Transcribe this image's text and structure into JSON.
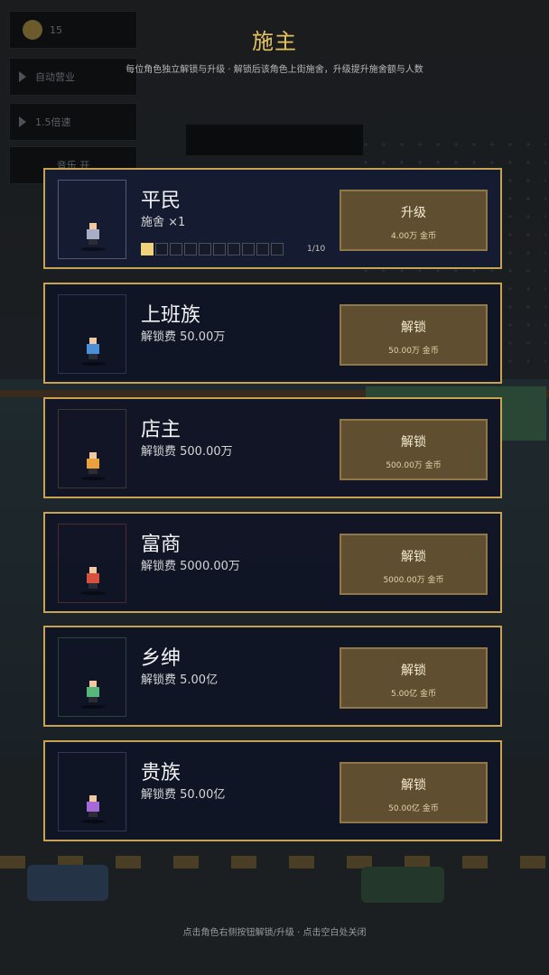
{
  "hud": {
    "coin_value": "15",
    "button1": "自动营业",
    "button2": "1.5倍速",
    "button3": "音乐 开"
  },
  "header": {
    "title": "施主",
    "subtitle": "每位角色独立解锁与升级 · 解锁后该角色上街施舍，升级提升施舍额与人数"
  },
  "colors": {
    "gold": "#c7a253",
    "title": "#e4c35e",
    "button": "#5f4f30"
  },
  "progress": {
    "filled": 1,
    "total": 10,
    "level_text": "1/10"
  },
  "cards": [
    {
      "name": "平民",
      "info": "施舍 ×1",
      "button_label": "升级",
      "button_price": "4.00万 金币",
      "shirt_color": "#a7aec5",
      "frame_color": "#505a74"
    },
    {
      "name": "上班族",
      "info": "解锁费 50.00万",
      "button_label": "解锁",
      "button_price": "50.00万 金币",
      "shirt_color": "#4a8fd8",
      "frame_color": "#2a3653"
    },
    {
      "name": "店主",
      "info": "解锁费 500.00万",
      "button_label": "解锁",
      "button_price": "500.00万 金币",
      "shirt_color": "#e8a13c",
      "frame_color": "#3e3632"
    },
    {
      "name": "富商",
      "info": "解锁费 5000.00万",
      "button_label": "解锁",
      "button_price": "5000.00万 金币",
      "shirt_color": "#d8503e",
      "frame_color": "#4a2b31"
    },
    {
      "name": "乡绅",
      "info": "解锁费 5.00亿",
      "button_label": "解锁",
      "button_price": "5.00亿 金币",
      "shirt_color": "#55b77a",
      "frame_color": "#2b4440"
    },
    {
      "name": "贵族",
      "info": "解锁费 50.00亿",
      "button_label": "解锁",
      "button_price": "50.00亿 金币",
      "shirt_color": "#a66ad8",
      "frame_color": "#3a3357"
    }
  ],
  "footer": "点击角色右侧按钮解锁/升级 · 点击空白处关闭"
}
